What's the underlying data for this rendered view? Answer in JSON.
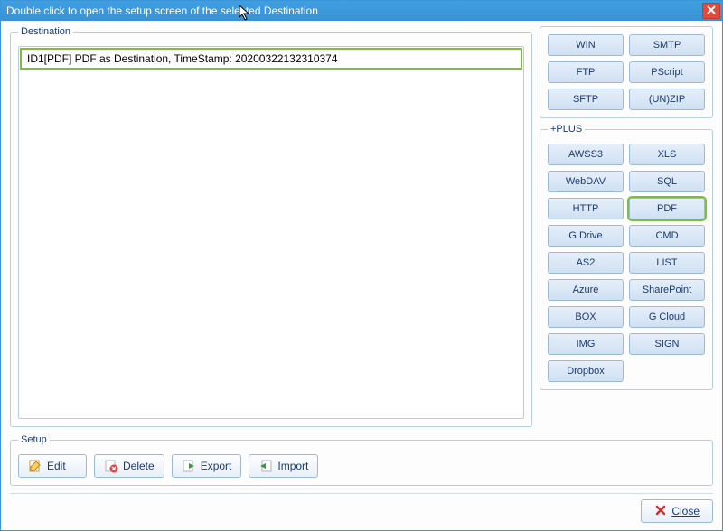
{
  "window": {
    "title": "Double click to open the setup screen of the selected Destination"
  },
  "destination": {
    "legend": "Destination",
    "items": [
      "ID1[PDF] PDF as Destination, TimeStamp: 20200322132310374"
    ]
  },
  "top_buttons": {
    "win": "WIN",
    "smtp": "SMTP",
    "ftp": "FTP",
    "pscript": "PScript",
    "sftp": "SFTP",
    "unzip": "(UN)ZIP"
  },
  "plus": {
    "legend": "+PLUS",
    "awss3": "AWSS3",
    "xls": "XLS",
    "webdav": "WebDAV",
    "sql": "SQL",
    "http": "HTTP",
    "pdf": "PDF",
    "gdrive": "G Drive",
    "cmd": "CMD",
    "as2": "AS2",
    "list": "LIST",
    "azure": "Azure",
    "sharepoint": "SharePoint",
    "box": "BOX",
    "gcloud": "G Cloud",
    "img": "IMG",
    "sign": "SIGN",
    "dropbox": "Dropbox"
  },
  "setup": {
    "legend": "Setup",
    "edit": "Edit",
    "delete": "Delete",
    "export": "Export",
    "import": "Import"
  },
  "footer": {
    "close": "Close"
  }
}
